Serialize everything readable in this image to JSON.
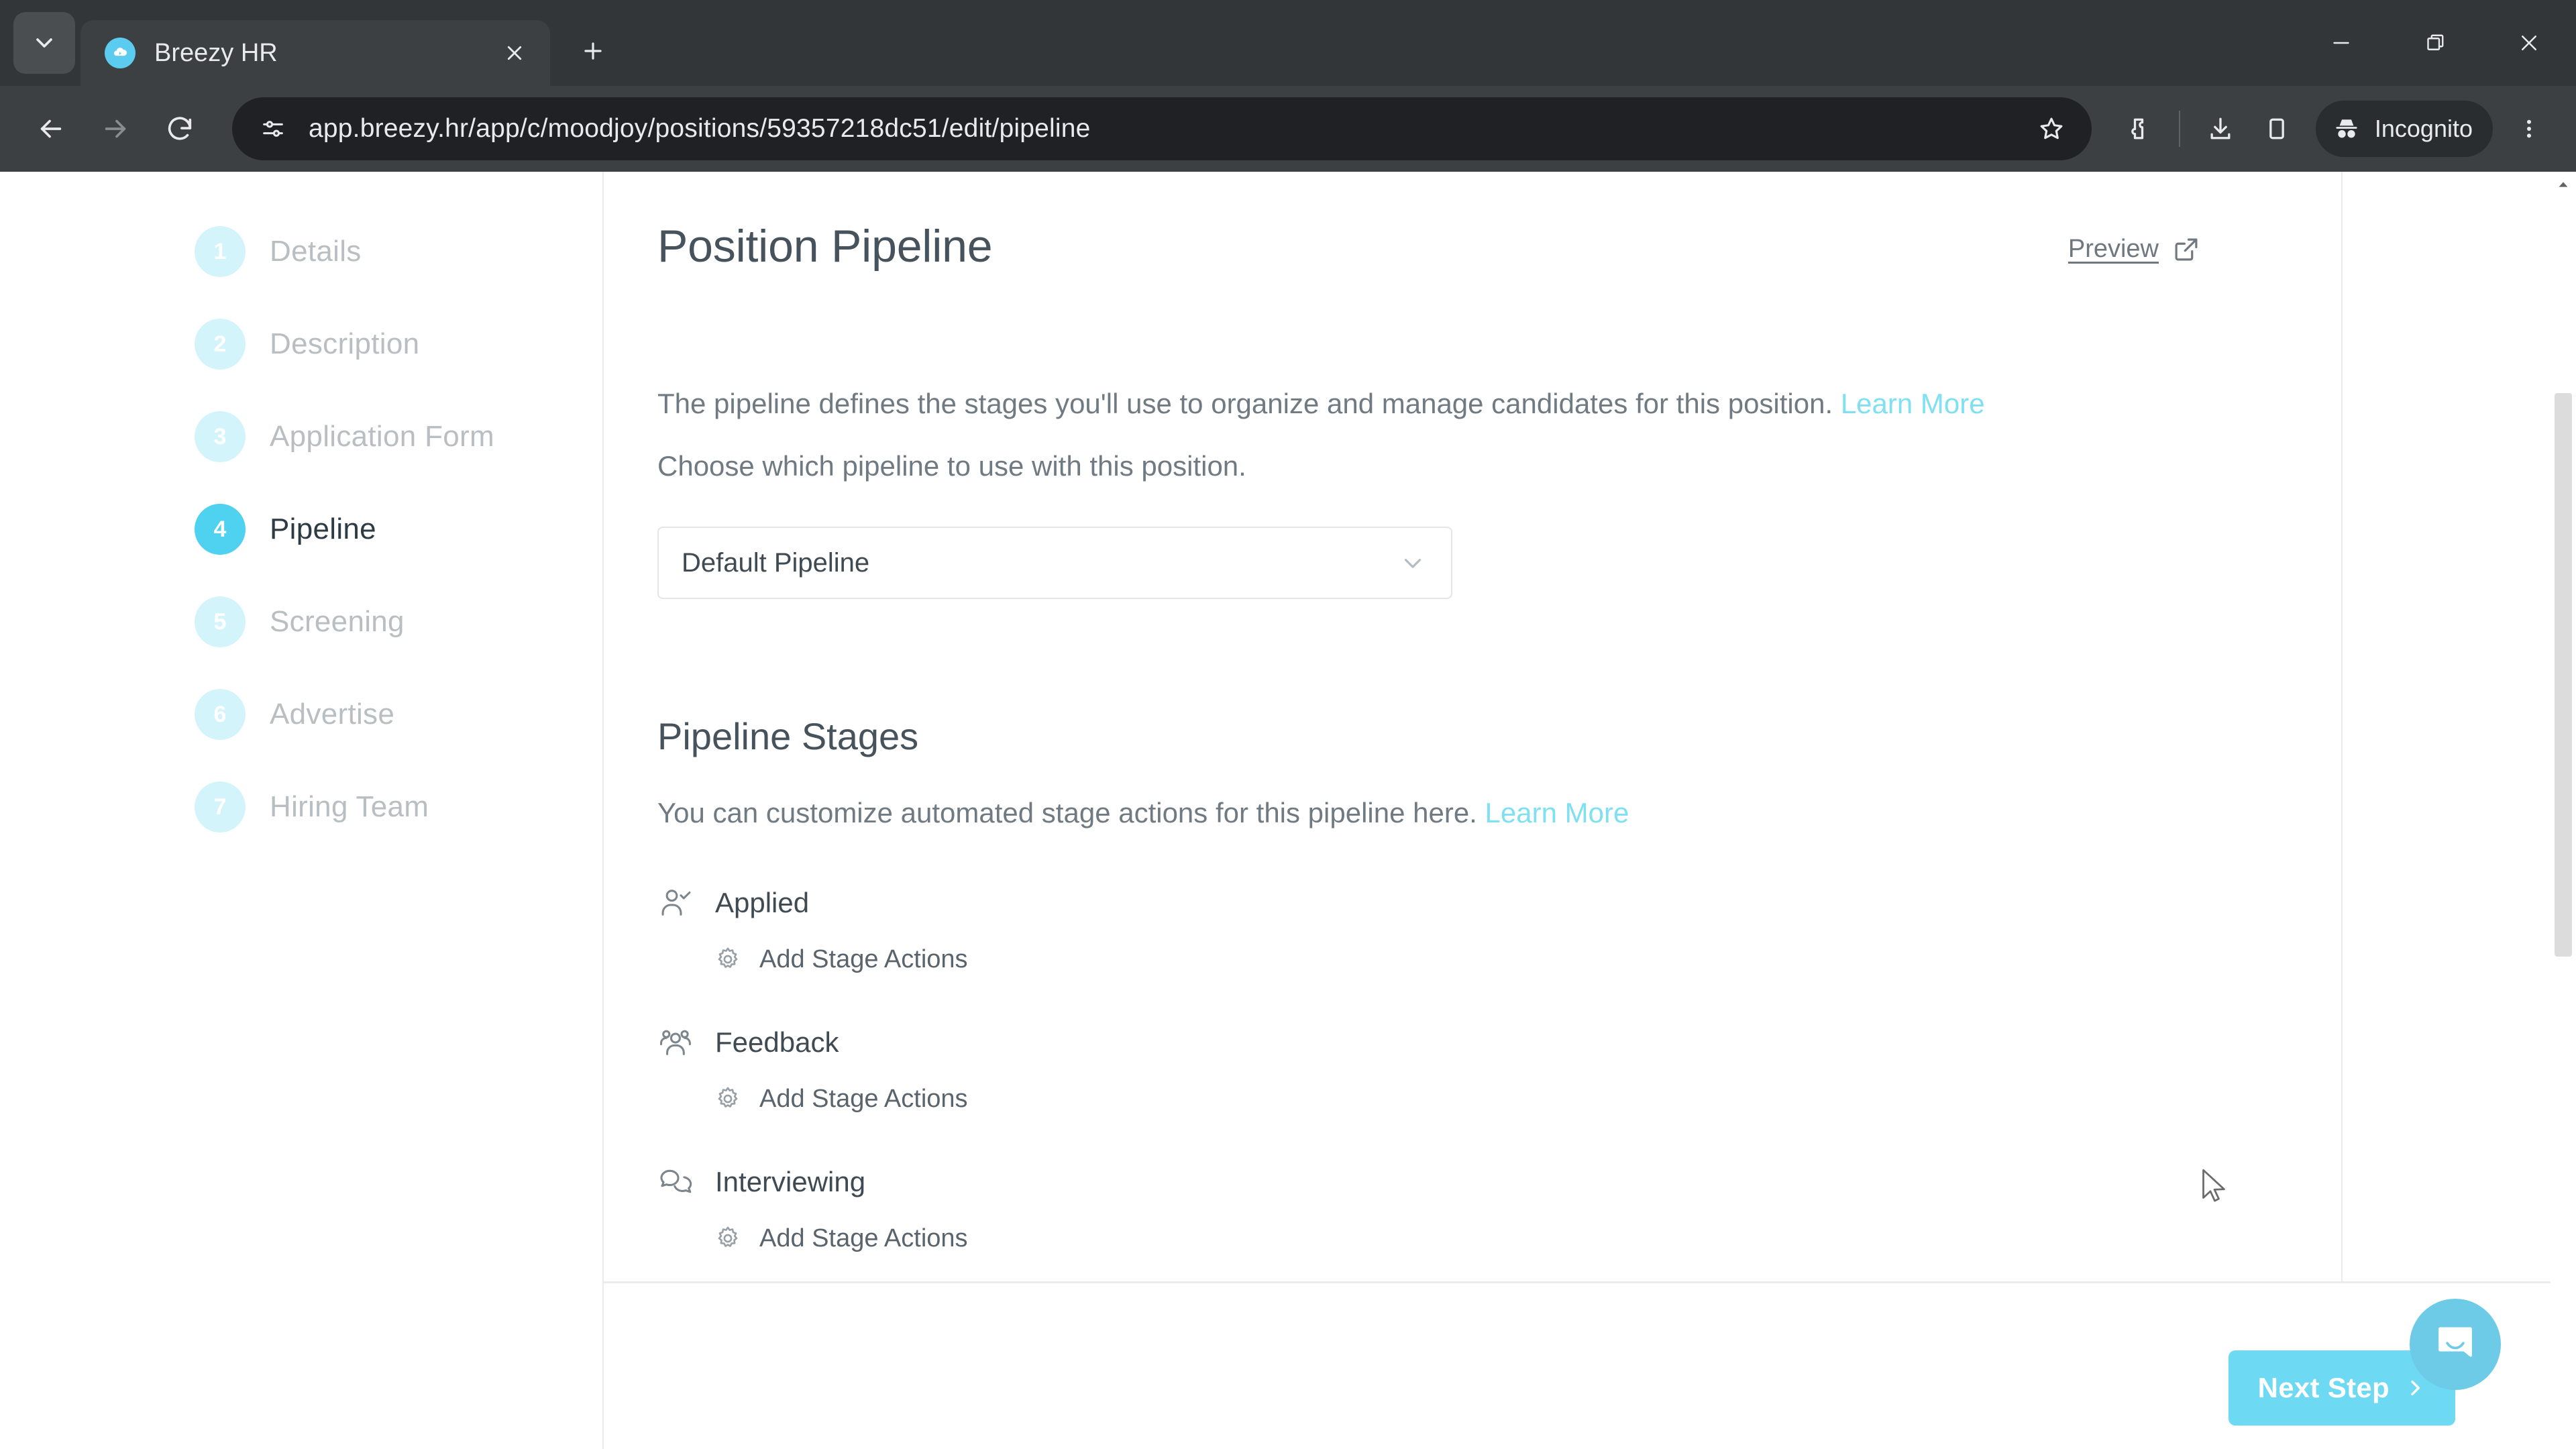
{
  "browser": {
    "tab": {
      "title": "Breezy HR",
      "favicon": "breezy-logo-icon"
    },
    "new_tab_tooltip": "New Tab",
    "url": "app.breezy.hr/app/c/moodjoy/positions/59357218dc51/edit/pipeline",
    "profile_chip": "Incognito",
    "window_controls": {
      "minimize": "—",
      "maximize": "□",
      "close": "✕"
    }
  },
  "sidebar": {
    "items": [
      {
        "number": "1",
        "label": "Details",
        "active": false
      },
      {
        "number": "2",
        "label": "Description",
        "active": false
      },
      {
        "number": "3",
        "label": "Application Form",
        "active": false
      },
      {
        "number": "4",
        "label": "Pipeline",
        "active": true
      },
      {
        "number": "5",
        "label": "Screening",
        "active": false
      },
      {
        "number": "6",
        "label": "Advertise",
        "active": false
      },
      {
        "number": "7",
        "label": "Hiring Team",
        "active": false
      }
    ]
  },
  "main": {
    "title": "Position Pipeline",
    "preview_label": "Preview",
    "intro_text": "The pipeline defines the stages you'll use to organize and manage candidates for this position.",
    "intro_link": "Learn More",
    "choose_text": "Choose which pipeline to use with this position.",
    "pipeline_select": {
      "value": "Default Pipeline",
      "options": [
        "Default Pipeline"
      ]
    },
    "stages_section": {
      "title": "Pipeline Stages",
      "description": "You can customize automated stage actions for this pipeline here.",
      "description_link": "Learn More",
      "add_action_label": "Add Stage Actions",
      "stages": [
        {
          "name": "Applied",
          "icon": "user-check-icon"
        },
        {
          "name": "Feedback",
          "icon": "users-icon"
        },
        {
          "name": "Interviewing",
          "icon": "chat-bubbles-icon"
        }
      ]
    },
    "footer": {
      "next_label": "Next Step"
    }
  },
  "widgets": {
    "intercom_label": "Open Intercom Messenger"
  },
  "colors": {
    "accent": "#6ed9f2",
    "accent_dark": "#4fd2f0",
    "accent_pale": "#d4f4fb",
    "link": "#7fe0f2",
    "text_dark": "#46525c",
    "text_muted": "#707a82",
    "chrome_bg": "#3c4043",
    "omnibox_bg": "#202124"
  }
}
